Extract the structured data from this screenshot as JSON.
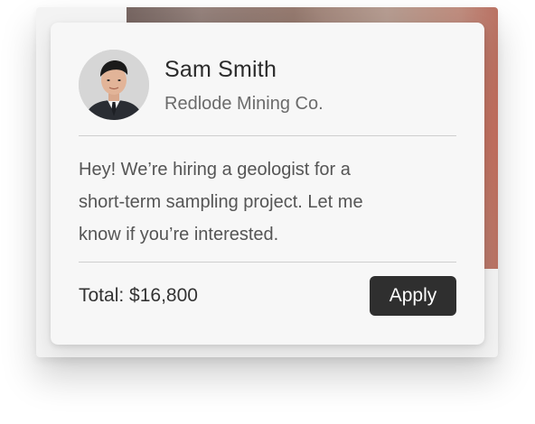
{
  "contact": {
    "name": "Sam Smith",
    "company": "Redlode Mining Co.",
    "avatar": "profile-photo"
  },
  "message": {
    "line1": "Hey! We’re hiring a geologist for a",
    "line2": "short-term sampling project. Let me",
    "line3": "know if you’re interested."
  },
  "footer": {
    "total": "Total: $16,800",
    "apply_label": "Apply"
  },
  "colors": {
    "card_bg": "#f7f7f7",
    "button_bg": "#2f2f2f",
    "button_text": "#ffffff",
    "name_text": "#2b2b2b",
    "body_text": "#555555"
  }
}
